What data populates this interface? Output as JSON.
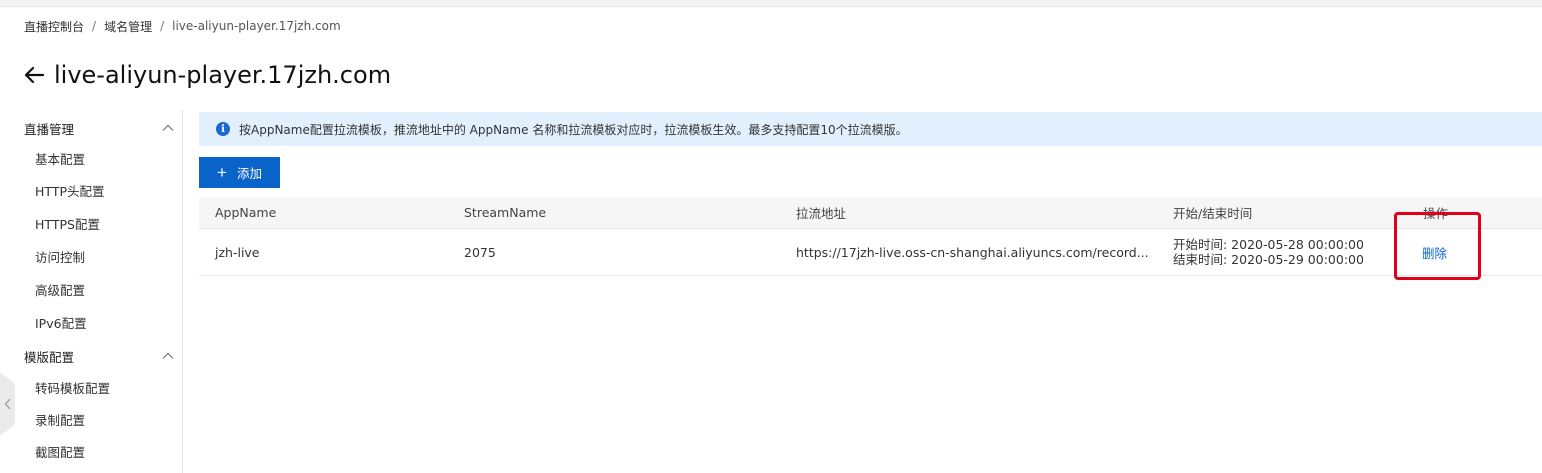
{
  "breadcrumb": {
    "items": [
      "直播控制台",
      "域名管理",
      "live-aliyun-player.17jzh.com"
    ],
    "separator": "/"
  },
  "page": {
    "title": "live-aliyun-player.17jzh.com"
  },
  "sidebar": {
    "groups": [
      {
        "label": "直播管理",
        "items": [
          "基本配置",
          "HTTP头配置",
          "HTTPS配置",
          "访问控制",
          "高级配置",
          "IPv6配置"
        ]
      },
      {
        "label": "模版配置",
        "items": [
          "转码模板配置",
          "录制配置",
          "截图配置"
        ]
      }
    ]
  },
  "notice": {
    "text": "按AppName配置拉流模板，推流地址中的 AppName 名称和拉流模板对应时，拉流模板生效。最多支持配置10个拉流模版。"
  },
  "toolbar": {
    "add_label": "添加"
  },
  "table": {
    "columns": [
      "AppName",
      "StreamName",
      "拉流地址",
      "开始/结束时间",
      "操作"
    ],
    "rows": [
      {
        "appname": "jzh-live",
        "streamname": "2075",
        "pull_url": "https://17jzh-live.oss-cn-shanghai.aliyuncs.com/record...",
        "start_time": "开始时间: 2020-05-28 00:00:00",
        "end_time": "结束时间: 2020-05-29 00:00:00",
        "action": "删除"
      }
    ]
  },
  "colors": {
    "primary": "#0a63c9",
    "notice_bg": "#e1f0fc",
    "highlight": "#e0001a"
  }
}
